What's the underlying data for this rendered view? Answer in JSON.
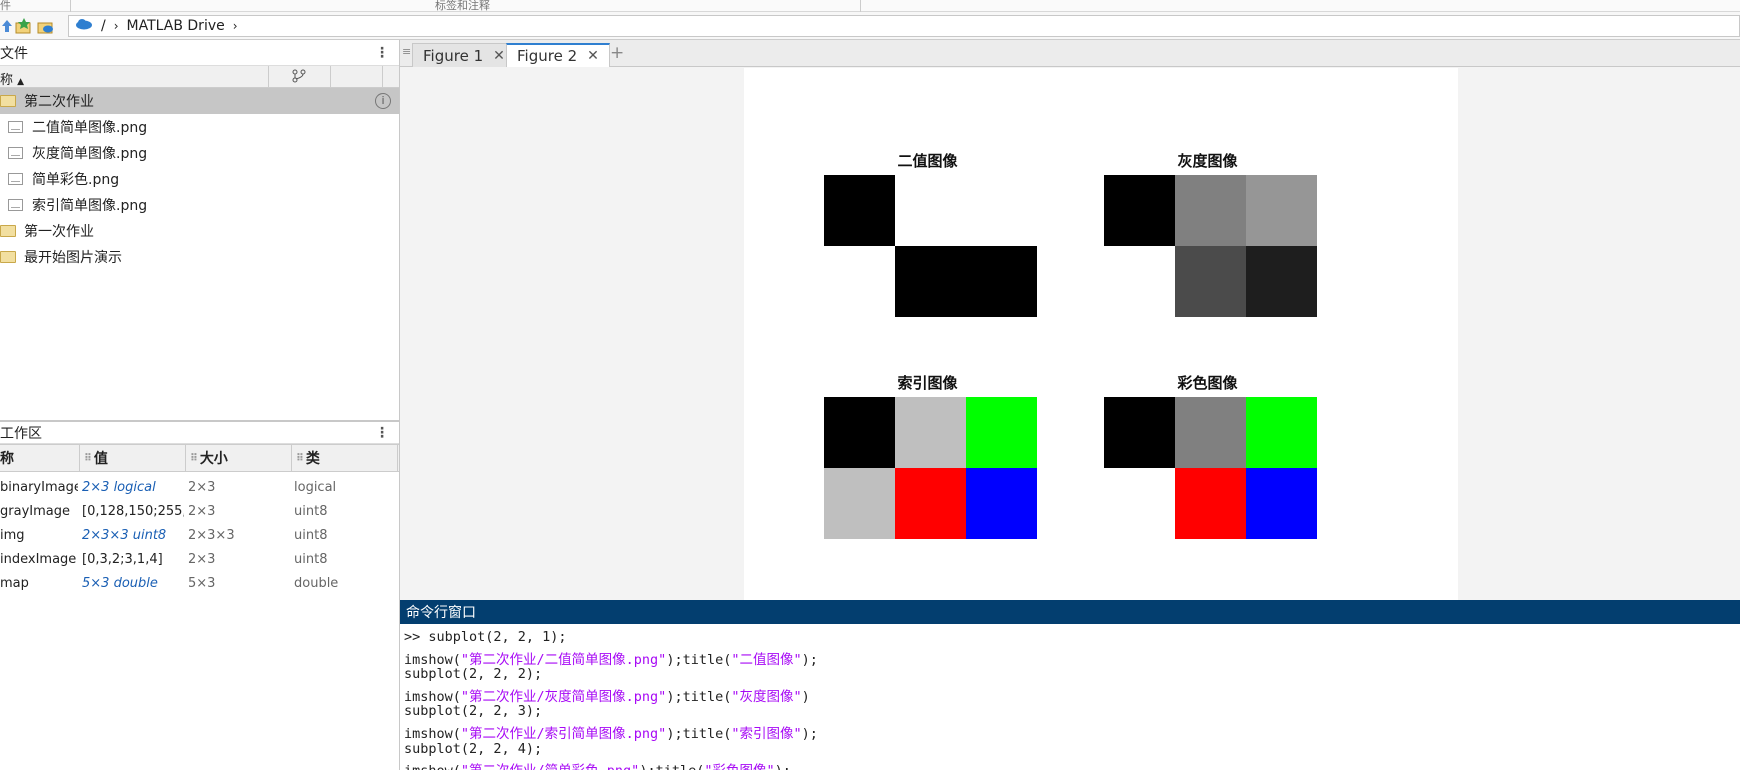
{
  "topstrip": {
    "left_label": "件",
    "center_label": "标签和注释"
  },
  "address": {
    "sep": "/",
    "location": "MATLAB Drive"
  },
  "filepanel": {
    "title": "文件",
    "col_name": "称",
    "items": [
      {
        "name": "第二次作业",
        "type": "folder",
        "selected": true,
        "indent": 0
      },
      {
        "name": "二值简单图像.png",
        "type": "image",
        "indent": 1
      },
      {
        "name": "灰度简单图像.png",
        "type": "image",
        "indent": 1
      },
      {
        "name": "简单彩色.png",
        "type": "image",
        "indent": 1
      },
      {
        "name": "索引简单图像.png",
        "type": "image",
        "indent": 1
      },
      {
        "name": "第一次作业",
        "type": "folder",
        "indent": 0
      },
      {
        "name": "最开始图片演示",
        "type": "folder",
        "indent": 0
      }
    ]
  },
  "workspace": {
    "title": "工作区",
    "headers": {
      "name": "称",
      "value": "值",
      "size": "大小",
      "class": "类"
    },
    "rows": [
      {
        "name": "binaryImage",
        "value": "2×3 logical",
        "value_style": "italic",
        "size": "2×3",
        "class": "logical"
      },
      {
        "name": "grayImage",
        "value": "[0,128,150;255,...",
        "value_style": "plain",
        "size": "2×3",
        "class": "uint8"
      },
      {
        "name": "img",
        "value": "2×3×3 uint8",
        "value_style": "italic",
        "size": "2×3×3",
        "class": "uint8"
      },
      {
        "name": "indexImage",
        "value": "[0,3,2;3,1,4]",
        "value_style": "plain",
        "size": "2×3",
        "class": "uint8"
      },
      {
        "name": "map",
        "value": "5×3 double",
        "value_style": "italic",
        "size": "5×3",
        "class": "double"
      }
    ]
  },
  "figure_tabs": [
    {
      "label": "Figure 1",
      "active": false
    },
    {
      "label": "Figure 2",
      "active": true
    }
  ],
  "subplots": [
    {
      "title": "二值图像",
      "grid": [
        [
          "#000000",
          "#ffffff",
          "#ffffff"
        ],
        [
          "#ffffff",
          "#000000",
          "#000000"
        ]
      ]
    },
    {
      "title": "灰度图像",
      "grid": [
        [
          "#000000",
          "#808080",
          "#969696"
        ],
        [
          "#ffffff",
          "#4b4b4b",
          "#1e1e1e"
        ]
      ]
    },
    {
      "title": "索引图像",
      "grid": [
        [
          "#000000",
          "#bfbfbf",
          "#00ff00"
        ],
        [
          "#bfbfbf",
          "#ff0000",
          "#0000ff"
        ]
      ]
    },
    {
      "title": "彩色图像",
      "grid": [
        [
          "#000000",
          "#808080",
          "#00ff00"
        ],
        [
          "#ffffff",
          "#ff0000",
          "#0000ff"
        ]
      ]
    }
  ],
  "command_window": {
    "title": "命令行窗口",
    "lines": [
      [
        {
          "t": ">> subplot(2, 2, 1);"
        }
      ],
      [
        {
          "t": "imshow("
        },
        {
          "t": "\"第二次作业/二值简单图像.png\"",
          "s": true
        },
        {
          "t": ");title("
        },
        {
          "t": "\"二值图像\"",
          "s": true
        },
        {
          "t": ");"
        }
      ],
      [
        {
          "t": "subplot(2, 2, 2);"
        }
      ],
      [
        {
          "t": "imshow("
        },
        {
          "t": "\"第二次作业/灰度简单图像.png\"",
          "s": true
        },
        {
          "t": ");title("
        },
        {
          "t": "\"灰度图像\"",
          "s": true
        },
        {
          "t": ")"
        }
      ],
      [
        {
          "t": "subplot(2, 2, 3);"
        }
      ],
      [
        {
          "t": "imshow("
        },
        {
          "t": "\"第二次作业/索引简单图像.png\"",
          "s": true
        },
        {
          "t": ");title("
        },
        {
          "t": "\"索引图像\"",
          "s": true
        },
        {
          "t": ");"
        }
      ],
      [
        {
          "t": "subplot(2, 2, 4);"
        }
      ],
      [
        {
          "t": "imshow("
        },
        {
          "t": "\"第二次作业/简单彩色.png\"",
          "s": true
        },
        {
          "t": ");title("
        },
        {
          "t": "\"彩色图像\"",
          "s": true
        },
        {
          "t": ");"
        }
      ]
    ]
  }
}
